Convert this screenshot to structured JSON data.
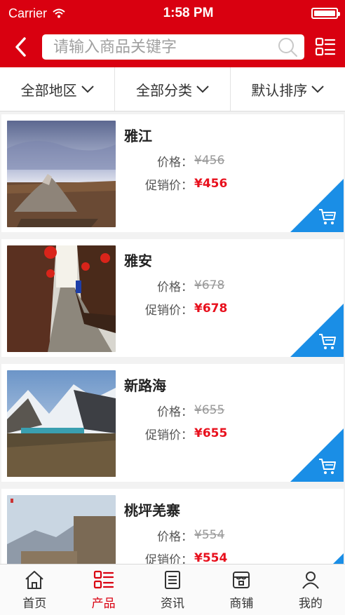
{
  "status_bar": {
    "carrier": "Carrier",
    "time": "1:58 PM"
  },
  "header": {
    "search_placeholder": "请输入商品关键字",
    "back_icon": "chevron-left-icon",
    "search_icon": "search-icon",
    "menu_icon": "list-menu-icon"
  },
  "filters": [
    {
      "label": "全部地区"
    },
    {
      "label": "全部分类"
    },
    {
      "label": "默认排序"
    }
  ],
  "colors": {
    "brand": "#d90010",
    "price": "#e8101d",
    "cart_accent": "#1a8ee6"
  },
  "labels": {
    "price": "价格：",
    "promo_price": "促销价："
  },
  "products": [
    {
      "name": "雅江",
      "price": "¥456",
      "promo_price": "¥456"
    },
    {
      "name": "雅安",
      "price": "¥678",
      "promo_price": "¥678"
    },
    {
      "name": "新路海",
      "price": "¥655",
      "promo_price": "¥655"
    },
    {
      "name": "桃坪羌寨",
      "price": "¥554",
      "promo_price": "¥554"
    }
  ],
  "tabs": [
    {
      "label": "首页",
      "icon": "home-icon"
    },
    {
      "label": "产品",
      "icon": "product-list-icon"
    },
    {
      "label": "资讯",
      "icon": "news-icon"
    },
    {
      "label": "商铺",
      "icon": "store-icon"
    },
    {
      "label": "我的",
      "icon": "user-icon"
    }
  ],
  "active_tab": "产品"
}
